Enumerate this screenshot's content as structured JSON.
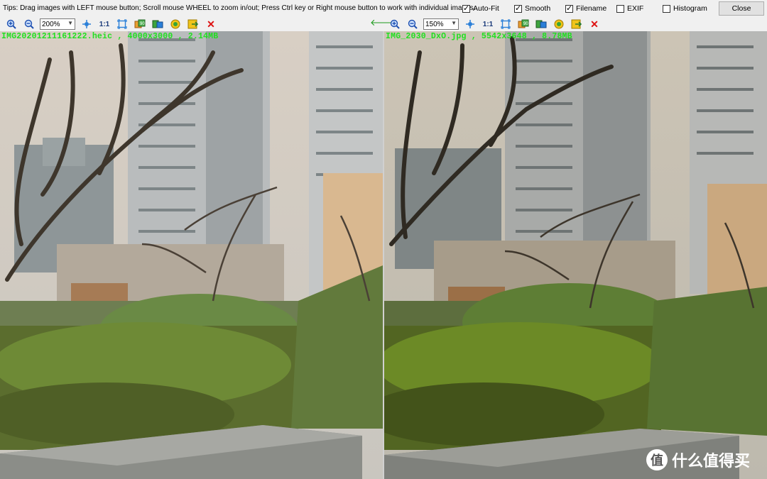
{
  "tipbar": {
    "tip": "Tips: Drag images with LEFT mouse button; Scroll mouse WHEEL to zoom in/out; Press Ctrl key or Right mouse button to work with individual images.",
    "options": [
      {
        "label": "Auto-Fit",
        "checked": true
      },
      {
        "label": "Smooth",
        "checked": true
      },
      {
        "label": "Filename",
        "checked": true
      },
      {
        "label": "EXIF",
        "checked": false
      },
      {
        "label": "Histogram",
        "checked": false
      }
    ],
    "close_label": "Close"
  },
  "left": {
    "zoom": "200%",
    "one_to_one": "1:1",
    "filename_overlay": "IMG20201211161222.heic , 4000x3000 , 2.14MB"
  },
  "right": {
    "zoom": "150%",
    "one_to_one": "1:1",
    "filename_overlay": "IMG_2030_DxO.jpg , 5542x3648 , 8.78MB"
  },
  "icons": {
    "zoom_in": "zoom-in-icon",
    "zoom_out": "zoom-out-icon",
    "fit": "fit-window-icon",
    "reset": "reset-view-icon",
    "rotate": "rotate-icon",
    "compare": "compare-icon",
    "save": "save-icon",
    "close": "close-image-icon",
    "sync_arrow": "arrow-left-icon"
  },
  "watermark": {
    "symbol": "值",
    "text": "什么值得买"
  }
}
